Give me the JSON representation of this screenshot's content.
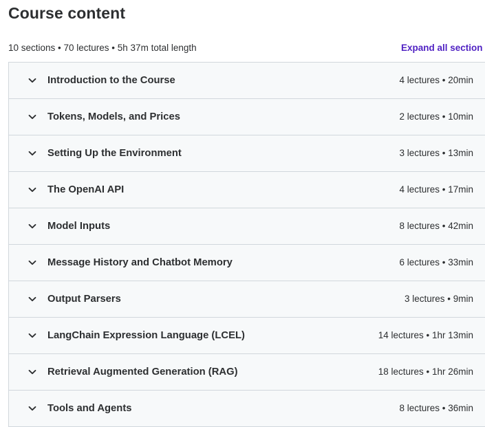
{
  "header": {
    "title": "Course content",
    "summary": "10 sections • 70 lectures • 5h 37m total length",
    "expand_all_label": "Expand all section"
  },
  "colors": {
    "link": "#5022c3",
    "section_bg": "#f7f9fa",
    "border": "#d1d7dc",
    "text": "#2d2f31"
  },
  "sections": [
    {
      "title": "Introduction to the Course",
      "meta": "4 lectures • 20min",
      "icon": "chevron-down-icon"
    },
    {
      "title": "Tokens, Models, and Prices",
      "meta": "2 lectures • 10min",
      "icon": "chevron-down-icon"
    },
    {
      "title": "Setting Up the Environment",
      "meta": "3 lectures • 13min",
      "icon": "chevron-down-icon"
    },
    {
      "title": "The OpenAI API",
      "meta": "4 lectures • 17min",
      "icon": "chevron-down-icon"
    },
    {
      "title": "Model Inputs",
      "meta": "8 lectures • 42min",
      "icon": "chevron-down-icon"
    },
    {
      "title": "Message History and Chatbot Memory",
      "meta": "6 lectures • 33min",
      "icon": "chevron-down-icon"
    },
    {
      "title": "Output Parsers",
      "meta": "3 lectures • 9min",
      "icon": "chevron-down-icon"
    },
    {
      "title": "LangChain Expression Language (LCEL)",
      "meta": "14 lectures • 1hr 13min",
      "icon": "chevron-down-icon"
    },
    {
      "title": "Retrieval Augmented Generation (RAG)",
      "meta": "18 lectures • 1hr 26min",
      "icon": "chevron-down-icon"
    },
    {
      "title": "Tools and Agents",
      "meta": "8 lectures • 36min",
      "icon": "chevron-down-icon"
    }
  ]
}
